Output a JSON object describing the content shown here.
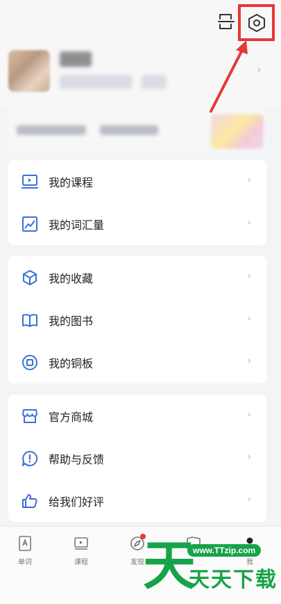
{
  "menu": {
    "group1": [
      {
        "label": "我的课程",
        "icon": "course-laptop-icon"
      },
      {
        "label": "我的词汇量",
        "icon": "vocabulary-chart-icon"
      }
    ],
    "group2": [
      {
        "label": "我的收藏",
        "icon": "cube-favorite-icon"
      },
      {
        "label": "我的图书",
        "icon": "open-book-icon"
      },
      {
        "label": "我的铜板",
        "icon": "coin-icon"
      }
    ],
    "group3": [
      {
        "label": "官方商城",
        "icon": "store-icon"
      },
      {
        "label": "帮助与反馈",
        "icon": "help-bubble-icon"
      },
      {
        "label": "给我们好评",
        "icon": "thumbs-up-icon"
      }
    ]
  },
  "bottom_nav": [
    {
      "label": "单词",
      "icon": "word-card-icon"
    },
    {
      "label": "课程",
      "icon": "course-play-icon"
    },
    {
      "label": "发现",
      "icon": "compass-icon",
      "badge": true
    },
    {
      "label": "",
      "icon": "reading-icon"
    },
    {
      "label": "我",
      "icon": "me-icon"
    }
  ],
  "watermark": {
    "big_char": "天",
    "url": "www.TTzip.com",
    "name": "天天下载"
  },
  "colors": {
    "accent_blue": "#3b6fd8",
    "highlight_red": "#e53935",
    "watermark_green": "#17a349"
  }
}
